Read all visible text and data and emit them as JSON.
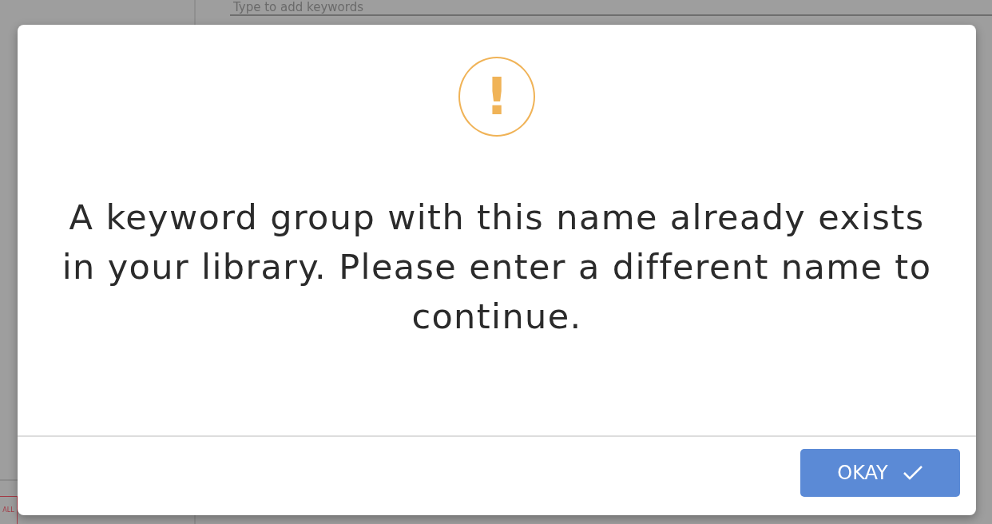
{
  "background": {
    "keywords_field": {
      "placeholder": "Type to add keywords"
    },
    "filter_button": {
      "label": "ALL"
    }
  },
  "dialog": {
    "icon": "!",
    "message": "A keyword group with this name already exists in your library. Please enter a different name to continue.",
    "buttons": [
      {
        "label": "OKAY",
        "kind": "confirm"
      }
    ]
  }
}
